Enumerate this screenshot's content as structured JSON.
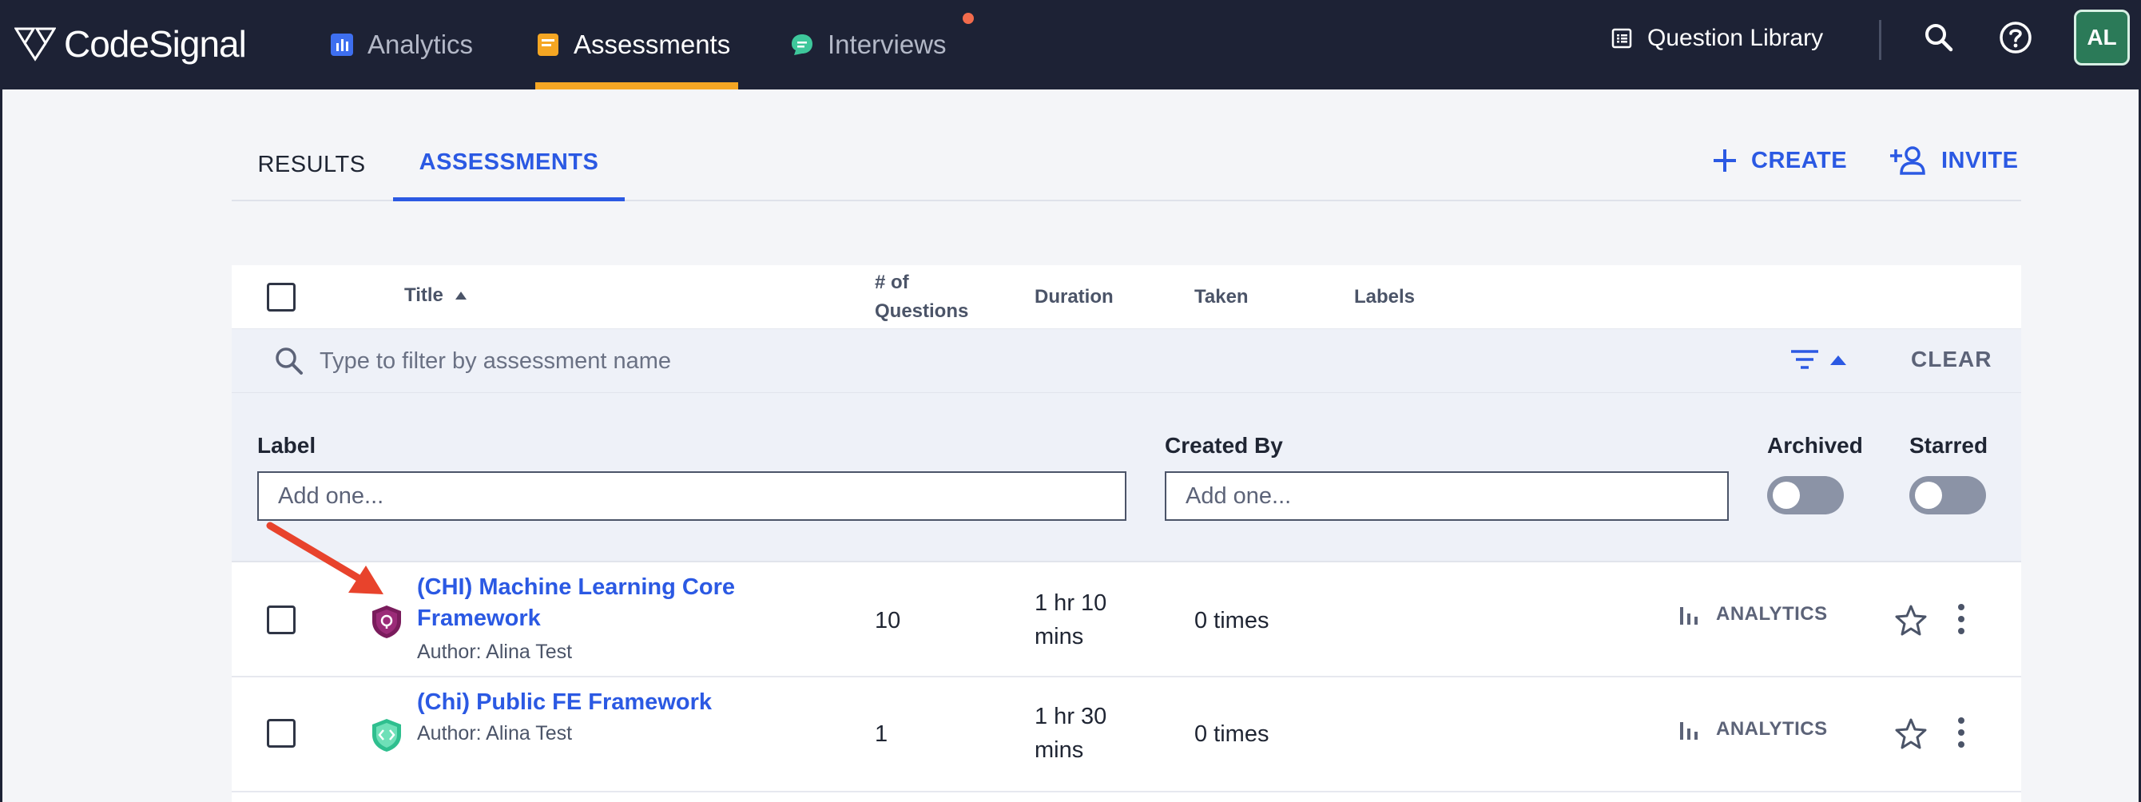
{
  "brand": {
    "name": "CodeSignal"
  },
  "topnav": {
    "items": [
      {
        "label": "Analytics",
        "active": false
      },
      {
        "label": "Assessments",
        "active": true
      },
      {
        "label": "Interviews",
        "active": false,
        "has_notification": true
      }
    ],
    "question_library": "Question Library",
    "avatar_initials": "AL"
  },
  "tabs": [
    {
      "label": "RESULTS",
      "active": false
    },
    {
      "label": "ASSESSMENTS",
      "active": true
    }
  ],
  "actions": {
    "create": "CREATE",
    "invite": "INVITE"
  },
  "table": {
    "columns": {
      "title": "Title",
      "questions": "# of\nQuestions",
      "duration": "Duration",
      "taken": "Taken",
      "labels": "Labels"
    },
    "filter_placeholder": "Type to filter by assessment name",
    "clear": "CLEAR",
    "filters": {
      "label": {
        "title": "Label",
        "placeholder": "Add one..."
      },
      "created_by": {
        "title": "Created By",
        "placeholder": "Add one..."
      },
      "archived": {
        "title": "Archived",
        "on": false
      },
      "starred": {
        "title": "Starred",
        "on": false
      }
    },
    "rows": [
      {
        "title": "(CHI) Machine Learning Core Framework",
        "author": "Author: Alina Test",
        "questions": "10",
        "duration": "1 hr 10\nmins",
        "taken": "0 times",
        "analytics": "ANALYTICS",
        "icon": "shield-purple-icon"
      },
      {
        "title": "(Chi) Public FE Framework",
        "author": "Author: Alina Test",
        "questions": "1",
        "duration": "1 hr 30\nmins",
        "taken": "0 times",
        "analytics": "ANALYTICS",
        "icon": "shield-teal-icon"
      }
    ]
  },
  "colors": {
    "nav_bg": "#1d2235",
    "accent": "#2b59e3",
    "nav_underline": "#f5a623",
    "annotation_arrow": "#e8432c"
  }
}
